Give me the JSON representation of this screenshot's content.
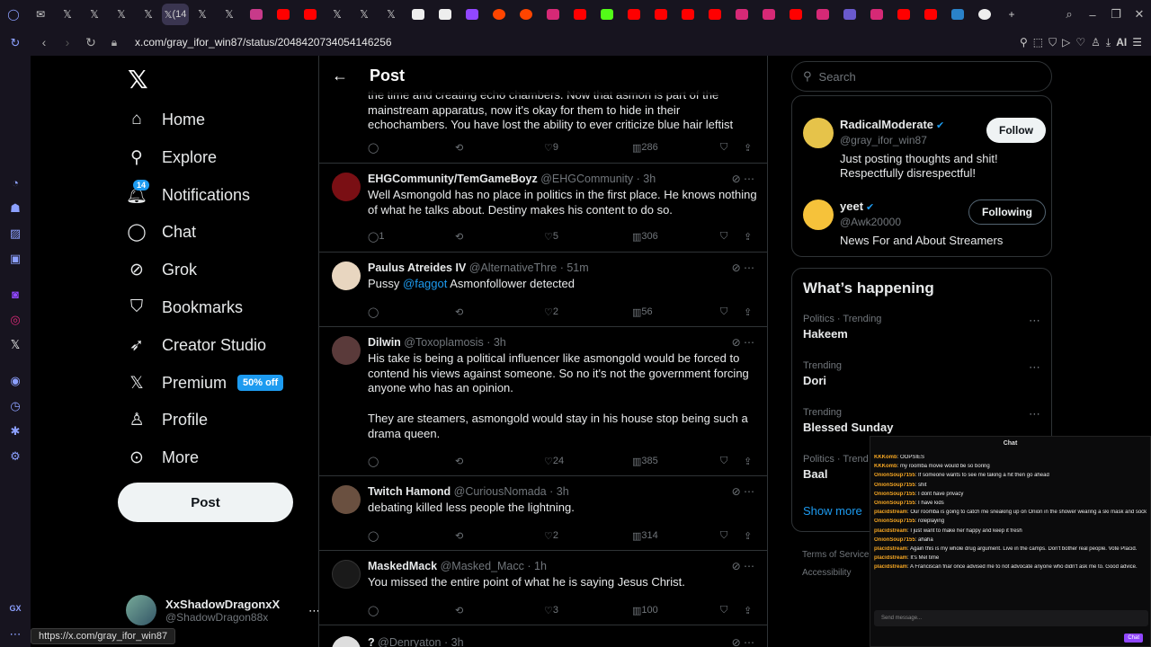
{
  "browser": {
    "active_tab_label": "(14",
    "url": "x.com/gray_ifor_win87/status/2048420734054146256",
    "hover_url": "https://x.com/gray_ifor_win87",
    "ai_label": "AI"
  },
  "nav": {
    "items": [
      {
        "label": "Home",
        "icon": "home-icon"
      },
      {
        "label": "Explore",
        "icon": "search-icon"
      },
      {
        "label": "Notifications",
        "icon": "bell-icon",
        "badge": "14"
      },
      {
        "label": "Chat",
        "icon": "chat-icon"
      },
      {
        "label": "Grok",
        "icon": "grok-icon"
      },
      {
        "label": "Bookmarks",
        "icon": "bookmark-icon"
      },
      {
        "label": "Creator Studio",
        "icon": "rocket-icon"
      },
      {
        "label": "Premium",
        "icon": "x-icon",
        "promo": "50% off"
      },
      {
        "label": "Profile",
        "icon": "person-icon"
      },
      {
        "label": "More",
        "icon": "more-circle-icon"
      }
    ],
    "post_button": "Post",
    "account": {
      "name": "XxShadowDragonxX",
      "handle": "@ShadowDragon88x"
    }
  },
  "feed": {
    "title": "Post",
    "partial_text": "the time and creating echo chambers. Now that asmon is part of the mainstream apparatus, now it's okay for them to hide in their echochambers. You have lost the ability to ever criticize blue hair leftist",
    "partial_stats": {
      "replies": "",
      "likes": "9",
      "views": "286"
    },
    "tweets": [
      {
        "name": "EHGCommunity/TemGameBoyz",
        "handle": "@EHGCommunity",
        "time": "· 3h",
        "text": "Well Asmongold has no place in politics in the first place. He knows nothing of what he talks about. Destiny makes his content to do so.",
        "replies": "1",
        "likes": "5",
        "views": "306",
        "avatar_color": "#7a0f14"
      },
      {
        "name": "Paulus Atreides IV",
        "handle": "@AlternativeThre",
        "time": "· 51m",
        "text_pre": "Pussy ",
        "mention": "@faggot",
        "text_post": " Asmonfollower detected",
        "replies": "",
        "likes": "2",
        "views": "56",
        "avatar_color": "#e8d6c0"
      },
      {
        "name": "Dilwin",
        "handle": "@Toxoplamosis",
        "time": "· 3h",
        "text": "His take is being a political influencer like asmongold would be forced to contend his views against someone. So no it's not the government forcing anyone who has an opinion.",
        "text2": "They are steamers, asmongold would stay in his house stop being such a drama queen.",
        "replies": "",
        "likes": "24",
        "views": "385",
        "avatar_color": "#5a3a3a"
      },
      {
        "name": "Twitch Hamond",
        "handle": "@CuriousNomada",
        "time": "· 3h",
        "text": "debating killed less people the lightning.",
        "replies": "",
        "likes": "2",
        "views": "314",
        "avatar_color": "#6a5040"
      },
      {
        "name": "MaskedMack",
        "handle": "@Masked_Macc",
        "time": "· 1h",
        "text": "You missed the entire point of what he is saying Jesus Christ.",
        "replies": "",
        "likes": "3",
        "views": "100",
        "avatar_color": "#1a1a1a"
      },
      {
        "name": "?",
        "handle": "@Denryaton",
        "time": "· 3h"
      }
    ]
  },
  "right": {
    "search_placeholder": "Search",
    "who_to_follow": [
      {
        "name": "RadicalModerate",
        "handle": "@gray_ifor_win87",
        "bio": "Just posting thoughts and shit! Respectfully disrespectful!",
        "button": "Follow"
      },
      {
        "name": "yeet",
        "handle": "@Awk20000",
        "bio": "News For and About Streamers",
        "button": "Following"
      }
    ],
    "happening_title": "What’s happening",
    "trends": [
      {
        "context": "Politics · Trending",
        "name": "Hakeem"
      },
      {
        "context": "Trending",
        "name": "Dori"
      },
      {
        "context": "Trending",
        "name": "Blessed Sunday"
      },
      {
        "context": "Politics · Trend",
        "name": "Baal"
      }
    ],
    "show_more": "Show more",
    "footer1": "Terms of Service",
    "footer2": "Accessibility"
  },
  "chat_overlay": {
    "title": "Chat",
    "messages": [
      {
        "user": "KKKomb",
        "text": ": OOPSIES",
        "color": "#f5a623"
      },
      {
        "user": "KKKomb",
        "text": ": my roomba movie would be so boring",
        "color": "#f5a623"
      },
      {
        "user": "OnionSoup7155",
        "text": ": If someone wants to see me taking a hit then go ahead",
        "color": "#f5a623"
      },
      {
        "user": "OnionSoup7155",
        "text": ": shit",
        "color": "#f5a623"
      },
      {
        "user": "OnionSoup7155",
        "text": ": I dont have privacy",
        "color": "#f5a623"
      },
      {
        "user": "OnionSoup7155",
        "text": ": I have kids",
        "color": "#f5a623"
      },
      {
        "user": "placidstream",
        "text": ": Our roomba is going to catch me sneaking up on Onion in the shower wearing a ski mask and sock and holding a pasta scoop",
        "color": "#f5a623"
      },
      {
        "user": "OnionSoup7155",
        "text": ": roleplaying",
        "color": "#f5a623"
      },
      {
        "user": "placidstream",
        "text": ": I just want to make her happy and keep it fresh",
        "color": "#f5a623"
      },
      {
        "user": "OnionSoup7155",
        "text": ": ahaha",
        "color": "#f5a623"
      },
      {
        "user": "placidstream",
        "text": ": Again this is my whole drug argument. Live in the camps. Don't bother real people. Vote Placid.",
        "color": "#f5a623"
      },
      {
        "user": "placidstream",
        "text": ": It's Mel time",
        "color": "#f5a623"
      },
      {
        "user": "placidstream",
        "text": ": A Franciscan friar once advised me to not advocate anyone who didn't ask me to. Good advice.",
        "color": "#f5a623"
      }
    ],
    "input_placeholder": "Send message...",
    "chat_button": "Chat"
  }
}
